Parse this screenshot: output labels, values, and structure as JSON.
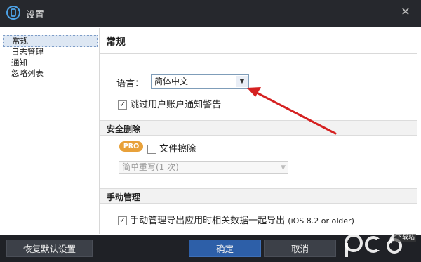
{
  "window": {
    "title": "设置",
    "close_icon": "close-icon"
  },
  "sidebar": {
    "items": [
      {
        "label": "常规"
      },
      {
        "label": "日志管理"
      },
      {
        "label": "通知"
      },
      {
        "label": "忽略列表"
      }
    ]
  },
  "main": {
    "title": "常规",
    "language": {
      "label": "语言：",
      "value": "简体中文"
    },
    "skip_warning": {
      "label": "跳过用户账户通知警告",
      "checked": true
    },
    "secure_delete": {
      "header": "安全删除",
      "badge": "PRO",
      "file_wipe": {
        "label": "文件擦除",
        "checked": false
      },
      "method": {
        "value": "简单重写(1 次)"
      }
    },
    "manual_manage": {
      "header": "手动管理",
      "export_option": {
        "label": "手动管理导出应用时相关数据一起导出",
        "note": "(iOS 8.2 or older)",
        "checked": true
      }
    }
  },
  "footer": {
    "reset_label": "恢复默认设置",
    "ok_label": "确定",
    "cancel_label": "取消"
  },
  "watermark": {
    "logo": "pc6",
    "text": "下载站"
  },
  "colors": {
    "accent": "#2d5fa8",
    "arrow": "#d52121",
    "badge": "#e8a13a"
  }
}
